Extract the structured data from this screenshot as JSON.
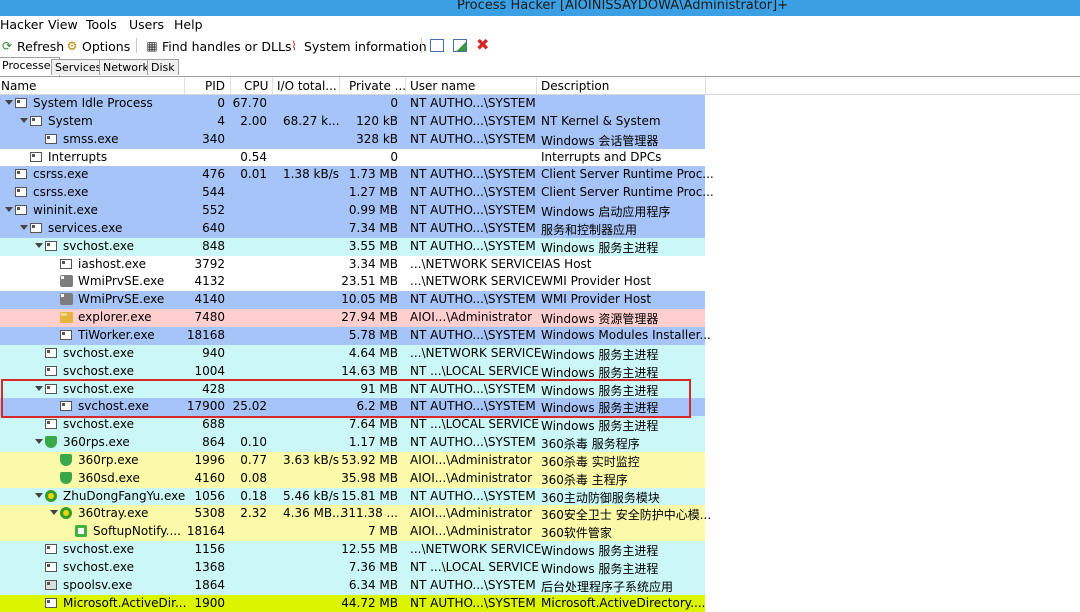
{
  "window": {
    "title": "Process Hacker [AIOINISSAYDOWA\\Administrator]+"
  },
  "menu": [
    "Hacker",
    "View",
    "Tools",
    "Users",
    "Help"
  ],
  "toolbar": {
    "refresh": "Refresh",
    "options": "Options",
    "find_handles": "Find handles or DLLs",
    "system_info": "System information"
  },
  "tabs": [
    "Processes",
    "Services",
    "Network",
    "Disk"
  ],
  "columns": {
    "name": "Name",
    "pid": "PID",
    "cpu": "CPU",
    "io": "I/O total...",
    "private": "Private ...",
    "user": "User name",
    "description": "Description"
  },
  "colors": {
    "system": "#a6c4f7",
    "service": "#ccf7f7",
    "own": "#fafaa8",
    "gui": "#ffcece",
    "white": "#ffffff",
    "dotnet": "#dbf500"
  },
  "rows": [
    {
      "name": "System Idle Process",
      "pid": "0",
      "cpu": "67.70",
      "io": "",
      "private": "0",
      "user": "NT AUTHO...\\SYSTEM",
      "description": "",
      "indent": 0,
      "toggle": true,
      "icon": "window-icon",
      "color": "system"
    },
    {
      "name": "System",
      "pid": "4",
      "cpu": "2.00",
      "io": "68.27 k...",
      "private": "120 kB",
      "user": "NT AUTHO...\\SYSTEM",
      "description": "NT Kernel & System",
      "indent": 1,
      "toggle": true,
      "icon": "window-icon",
      "color": "system"
    },
    {
      "name": "smss.exe",
      "pid": "340",
      "cpu": "",
      "io": "",
      "private": "328 kB",
      "user": "NT AUTHO...\\SYSTEM",
      "description": "Windows 会话管理器",
      "indent": 2,
      "toggle": false,
      "icon": "window-icon",
      "color": "system"
    },
    {
      "name": "Interrupts",
      "pid": "",
      "cpu": "0.54",
      "io": "",
      "private": "0",
      "user": "",
      "description": "Interrupts and DPCs",
      "indent": 1,
      "toggle": false,
      "icon": "window-icon",
      "color": "white"
    },
    {
      "name": "csrss.exe",
      "pid": "476",
      "cpu": "0.01",
      "io": "1.38 kB/s",
      "private": "1.73 MB",
      "user": "NT AUTHO...\\SYSTEM",
      "description": "Client Server Runtime Proc...",
      "indent": 0,
      "toggle": false,
      "icon": "window-icon",
      "color": "system"
    },
    {
      "name": "csrss.exe",
      "pid": "544",
      "cpu": "",
      "io": "",
      "private": "1.27 MB",
      "user": "NT AUTHO...\\SYSTEM",
      "description": "Client Server Runtime Proc...",
      "indent": 0,
      "toggle": false,
      "icon": "window-icon",
      "color": "system"
    },
    {
      "name": "wininit.exe",
      "pid": "552",
      "cpu": "",
      "io": "",
      "private": "0.99 MB",
      "user": "NT AUTHO...\\SYSTEM",
      "description": "Windows 启动应用程序",
      "indent": 0,
      "toggle": true,
      "icon": "window-icon",
      "color": "system"
    },
    {
      "name": "services.exe",
      "pid": "640",
      "cpu": "",
      "io": "",
      "private": "7.34 MB",
      "user": "NT AUTHO...\\SYSTEM",
      "description": "服务和控制器应用",
      "indent": 1,
      "toggle": true,
      "icon": "window-icon",
      "color": "system"
    },
    {
      "name": "svchost.exe",
      "pid": "848",
      "cpu": "",
      "io": "",
      "private": "3.55 MB",
      "user": "NT AUTHO...\\SYSTEM",
      "description": "Windows 服务主进程",
      "indent": 2,
      "toggle": true,
      "icon": "window-icon",
      "color": "service"
    },
    {
      "name": "iashost.exe",
      "pid": "3792",
      "cpu": "",
      "io": "",
      "private": "3.34 MB",
      "user": "...\\NETWORK SERVICE",
      "description": "IAS Host",
      "indent": 3,
      "toggle": false,
      "icon": "window-icon",
      "color": "white"
    },
    {
      "name": "WmiPrvSE.exe",
      "pid": "4132",
      "cpu": "",
      "io": "",
      "private": "23.51 MB",
      "user": "...\\NETWORK SERVICE",
      "description": "WMI Provider Host",
      "indent": 3,
      "toggle": false,
      "icon": "cog-icon",
      "color": "white"
    },
    {
      "name": "WmiPrvSE.exe",
      "pid": "4140",
      "cpu": "",
      "io": "",
      "private": "10.05 MB",
      "user": "NT AUTHO...\\SYSTEM",
      "description": "WMI Provider Host",
      "indent": 3,
      "toggle": false,
      "icon": "cog-icon",
      "color": "system"
    },
    {
      "name": "explorer.exe",
      "pid": "7480",
      "cpu": "",
      "io": "",
      "private": "27.94 MB",
      "user": "AIOI...\\Administrator",
      "description": "Windows 资源管理器",
      "indent": 3,
      "toggle": false,
      "icon": "folder-icon",
      "color": "gui"
    },
    {
      "name": "TiWorker.exe",
      "pid": "18168",
      "cpu": "",
      "io": "",
      "private": "5.78 MB",
      "user": "NT AUTHO...\\SYSTEM",
      "description": "Windows Modules Installer...",
      "indent": 3,
      "toggle": false,
      "icon": "window-icon",
      "color": "system"
    },
    {
      "name": "svchost.exe",
      "pid": "940",
      "cpu": "",
      "io": "",
      "private": "4.64 MB",
      "user": "...\\NETWORK SERVICE",
      "description": "Windows 服务主进程",
      "indent": 2,
      "toggle": false,
      "icon": "window-icon",
      "color": "service"
    },
    {
      "name": "svchost.exe",
      "pid": "1004",
      "cpu": "",
      "io": "",
      "private": "14.63 MB",
      "user": "NT ...\\LOCAL SERVICE",
      "description": "Windows 服务主进程",
      "indent": 2,
      "toggle": false,
      "icon": "window-icon",
      "color": "service"
    },
    {
      "name": "svchost.exe",
      "pid": "428",
      "cpu": "",
      "io": "",
      "private": "91 MB",
      "user": "NT AUTHO...\\SYSTEM",
      "description": "Windows 服务主进程",
      "indent": 2,
      "toggle": true,
      "icon": "window-icon",
      "color": "service"
    },
    {
      "name": "svchost.exe",
      "pid": "17900",
      "cpu": "25.02",
      "io": "",
      "private": "6.2 MB",
      "user": "NT AUTHO...\\SYSTEM",
      "description": "Windows 服务主进程",
      "indent": 3,
      "toggle": false,
      "icon": "window-icon",
      "color": "system"
    },
    {
      "name": "svchost.exe",
      "pid": "688",
      "cpu": "",
      "io": "",
      "private": "7.64 MB",
      "user": "NT ...\\LOCAL SERVICE",
      "description": "Windows 服务主进程",
      "indent": 2,
      "toggle": false,
      "icon": "window-icon",
      "color": "service"
    },
    {
      "name": "360rps.exe",
      "pid": "864",
      "cpu": "0.10",
      "io": "",
      "private": "1.17 MB",
      "user": "NT AUTHO...\\SYSTEM",
      "description": "360杀毒 服务程序",
      "indent": 2,
      "toggle": true,
      "icon": "shield-icon",
      "color": "service"
    },
    {
      "name": "360rp.exe",
      "pid": "1996",
      "cpu": "0.77",
      "io": "3.63 kB/s",
      "private": "53.92 MB",
      "user": "AIOI...\\Administrator",
      "description": "360杀毒 实时监控",
      "indent": 3,
      "toggle": false,
      "icon": "shield-icon",
      "color": "own"
    },
    {
      "name": "360sd.exe",
      "pid": "4160",
      "cpu": "0.08",
      "io": "",
      "private": "35.98 MB",
      "user": "AIOI...\\Administrator",
      "description": "360杀毒 主程序",
      "indent": 3,
      "toggle": false,
      "icon": "shield-icon",
      "color": "own"
    },
    {
      "name": "ZhuDongFangYu.exe",
      "pid": "1056",
      "cpu": "0.18",
      "io": "5.46 kB/s",
      "private": "15.81 MB",
      "user": "NT AUTHO...\\SYSTEM",
      "description": "360主动防御服务模块",
      "indent": 2,
      "toggle": true,
      "icon": "guard-icon",
      "color": "service"
    },
    {
      "name": "360tray.exe",
      "pid": "5308",
      "cpu": "2.32",
      "io": "4.36 MB...",
      "private": "311.38 ...",
      "user": "AIOI...\\Administrator",
      "description": "360安全卫士 安全防护中心模...",
      "indent": 3,
      "toggle": true,
      "icon": "guard-icon",
      "color": "own"
    },
    {
      "name": "SoftupNotify....",
      "pid": "18164",
      "cpu": "",
      "io": "",
      "private": "7 MB",
      "user": "AIOI...\\Administrator",
      "description": "360软件管家",
      "indent": 4,
      "toggle": false,
      "icon": "softup-icon",
      "color": "own"
    },
    {
      "name": "svchost.exe",
      "pid": "1156",
      "cpu": "",
      "io": "",
      "private": "12.55 MB",
      "user": "...\\NETWORK SERVICE",
      "description": "Windows 服务主进程",
      "indent": 2,
      "toggle": false,
      "icon": "window-icon",
      "color": "service"
    },
    {
      "name": "svchost.exe",
      "pid": "1368",
      "cpu": "",
      "io": "",
      "private": "7.36 MB",
      "user": "NT ...\\LOCAL SERVICE",
      "description": "Windows 服务主进程",
      "indent": 2,
      "toggle": false,
      "icon": "window-icon",
      "color": "service"
    },
    {
      "name": "spoolsv.exe",
      "pid": "1864",
      "cpu": "",
      "io": "",
      "private": "6.34 MB",
      "user": "NT AUTHO...\\SYSTEM",
      "description": "后台处理程序子系统应用",
      "indent": 2,
      "toggle": false,
      "icon": "printer-icon",
      "color": "service"
    },
    {
      "name": "Microsoft.ActiveDir...",
      "pid": "1900",
      "cpu": "",
      "io": "",
      "private": "44.72 MB",
      "user": "NT AUTHO...\\SYSTEM",
      "description": "Microsoft.ActiveDirectory....",
      "indent": 2,
      "toggle": false,
      "icon": "window-icon",
      "color": "dotnet"
    }
  ]
}
